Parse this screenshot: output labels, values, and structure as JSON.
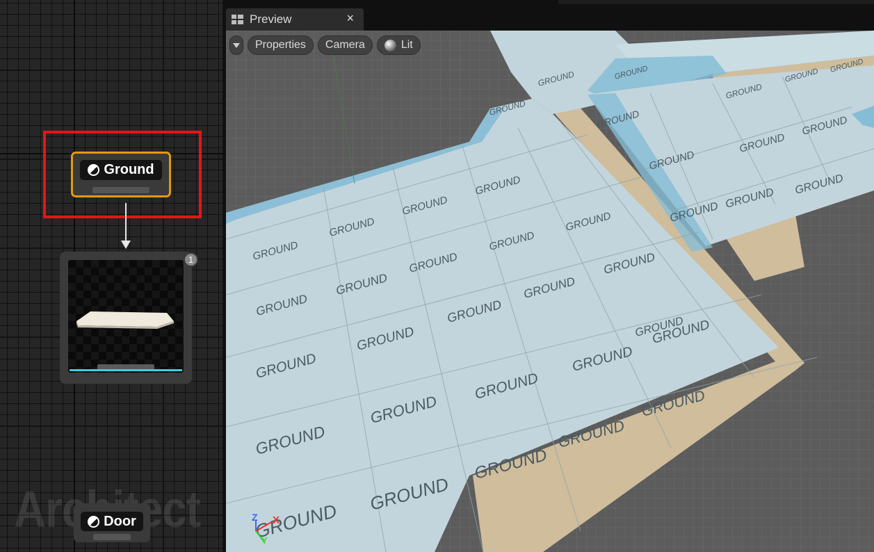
{
  "graph": {
    "ground_node": {
      "label": "Ground",
      "icon": "half-circle-icon",
      "border_color": "#e19a12"
    },
    "preview_node": {
      "badge_count": "1",
      "accent_color": "#33d3e0"
    },
    "door_node": {
      "label": "Door",
      "icon": "half-circle-icon"
    },
    "watermark": "Architect",
    "highlight_color": "#e5141a"
  },
  "preview_panel": {
    "tab": {
      "title": "Preview",
      "close_label": "×",
      "icon": "viewport-layout-icon"
    },
    "toolbar": {
      "menu_icon": "chevron-down-icon",
      "properties_label": "Properties",
      "camera_label": "Camera",
      "lit_label": "Lit"
    },
    "viewport": {
      "tile_label": "GROUND",
      "axis": {
        "z": "Z",
        "x": "X",
        "y": "Y"
      },
      "colors": {
        "floor": "#c3d5dc",
        "floor_selected": "#86bdd6",
        "path": "#cfbd9c",
        "background": "#5c5c5c"
      }
    }
  }
}
